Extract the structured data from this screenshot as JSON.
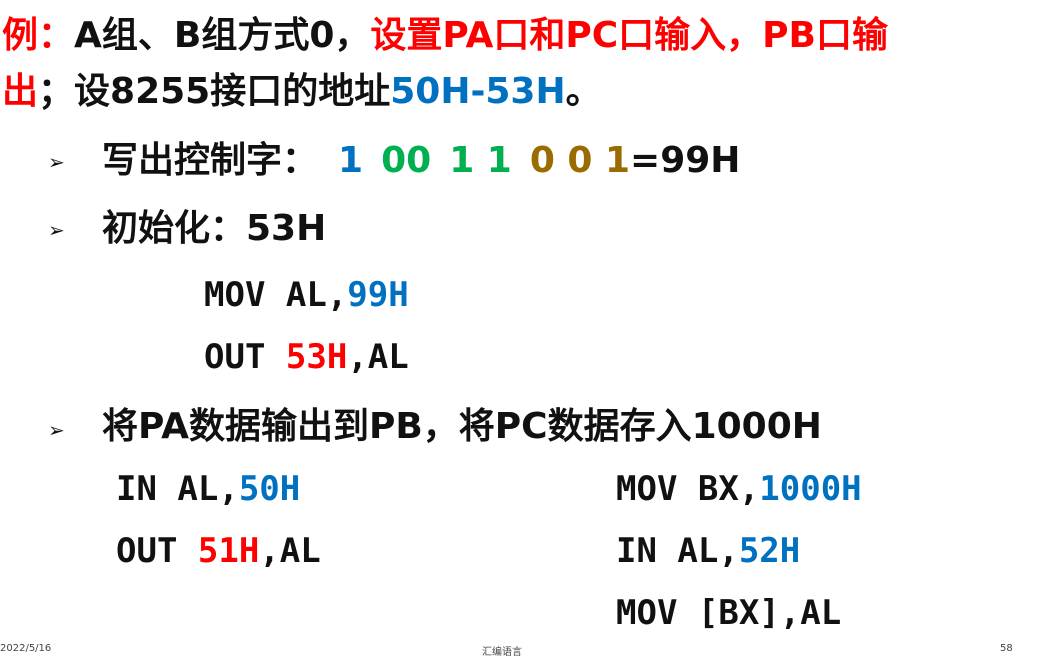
{
  "title": {
    "prefix_red": "例：",
    "black1": "A组、B组方式0，",
    "red1": "设置PA口和PC口输入，PB口输",
    "line2_red": "出",
    "line2_black": "；设8255接口的地址",
    "line2_blue": "50H-53H",
    "line2_end": "。"
  },
  "control_word": {
    "label": "写出控制字：",
    "bit1": "1",
    "bits_green": "00",
    "bits_green2": "1 1",
    "bits_brown": "0 0 1",
    "result": "=99H"
  },
  "init": {
    "label": "初始化：53H",
    "mov_prefix": "MOV AL,",
    "mov_value": "99H",
    "out_prefix": "OUT ",
    "out_port": "53H",
    "out_suffix": ",AL"
  },
  "transfer": {
    "label": "将PA数据输出到PB，将PC数据存入1000H",
    "left": {
      "in_prefix": "IN AL,",
      "in_port": "50H",
      "out_prefix": "OUT ",
      "out_port": "51H",
      "out_suffix": ",AL"
    },
    "right": {
      "mov_prefix": "MOV BX,",
      "mov_value": "1000H",
      "in_prefix": "IN AL,",
      "in_port": "52H",
      "store": "MOV [BX],AL"
    }
  },
  "footer": {
    "date": "2022/5/16",
    "center": "汇编语言",
    "page": "58"
  },
  "colors": {
    "red": "#ff0000",
    "blue": "#0070c0",
    "green": "#00b050",
    "brown": "#9a6b00"
  }
}
